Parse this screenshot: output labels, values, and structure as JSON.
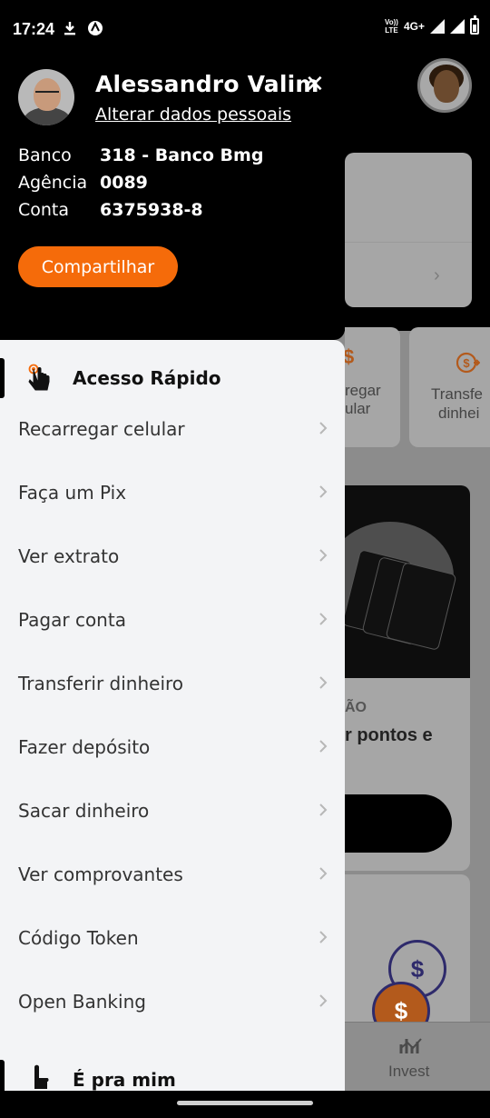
{
  "status_bar": {
    "time": "17:24",
    "network_label_top": "Vo))",
    "network_label_bottom": "LTE",
    "network_type": "4G+",
    "icons": [
      "download-icon",
      "app-notification-icon",
      "volte-icon",
      "signal-icon",
      "signal-icon",
      "battery-icon"
    ]
  },
  "profile": {
    "name": "Alessandro Valim",
    "edit_link": "Alterar dados pessoais",
    "close_label": "✕",
    "bank_label": "Banco",
    "bank_value": "318 - Banco Bmg",
    "agency_label": "Agência",
    "agency_value": "0089",
    "account_label": "Conta",
    "account_value": "6375938-8",
    "share_button": "Compartilhar"
  },
  "colors": {
    "accent": "#f56b0a",
    "drawer_bg": "#f3f4f6",
    "header_bg": "#000000",
    "text": "#333333"
  },
  "menu": {
    "quick_access_title": "Acesso Rápido",
    "items": [
      {
        "label": "Recarregar celular"
      },
      {
        "label": "Faça um Pix"
      },
      {
        "label": "Ver extrato"
      },
      {
        "label": "Pagar conta"
      },
      {
        "label": "Transferir dinheiro"
      },
      {
        "label": "Fazer depósito"
      },
      {
        "label": "Sacar dinheiro"
      },
      {
        "label": "Ver comprovantes"
      },
      {
        "label": "Código Token"
      },
      {
        "label": "Open Banking"
      }
    ],
    "next_section_title": "É pra mim"
  },
  "background": {
    "quick_1_line1": "regar",
    "quick_1_line2": "ular",
    "quick_2_line1": "Transfe",
    "quick_2_line2": "dinhei",
    "promo_subtitle": "ÃO",
    "promo_title": "r pontos e",
    "coin_symbol": "$",
    "tab_invest": "Invest"
  }
}
